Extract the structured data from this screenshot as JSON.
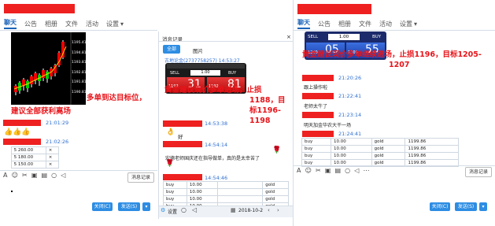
{
  "left": {
    "tabs": [
      "聊天",
      "公告",
      "相册",
      "文件",
      "活动",
      "设置"
    ],
    "chart_prices": [
      "1195.41",
      "1194.81",
      "1193.81",
      "1192.81",
      "1191.81",
      "1190.81",
      "1189.81"
    ],
    "msg1": "多单到达目标位，",
    "msg2": "建议全部获利离场",
    "time1": "21:01:29",
    "time2": "21:02:26",
    "rows": [
      {
        "value": "5 260.00",
        "close": "×"
      },
      {
        "value": "5 180.00",
        "close": "×"
      },
      {
        "value": "5 150.00",
        "close": "×"
      }
    ],
    "history_label": "消息记录",
    "close_btn": "关闭(C)",
    "send_btn": "发送(S)"
  },
  "mid": {
    "title": "消息记录",
    "tab_all": "全部",
    "tab_pic": "图片",
    "sender_line": "古地论金(2737758257) 14:53:27",
    "ticket": {
      "sell": "SELL",
      "buy": "BUY",
      "lot": "1.00",
      "sell_small": "1192",
      "sell_big": "31",
      "buy_small": "1192",
      "buy_big": "81"
    },
    "msg": "黄金建议现价多单进场，止损1188，目标1196-1198",
    "time1": "14:53:38",
    "good": "好",
    "time2": "14:54:14",
    "long_msg": "宏德老师国庆还在指导做单，真的是太幸苦了",
    "time3": "14:54:46",
    "table": [
      [
        "buy",
        "10.00",
        "gold"
      ],
      [
        "buy",
        "10.00",
        "gold"
      ],
      [
        "buy",
        "10.00",
        "gold"
      ],
      [
        "buy",
        "10.00",
        "gold"
      ]
    ],
    "settings": "设置",
    "date": "2018-10-2"
  },
  "right": {
    "tabs": [
      "聊天",
      "公告",
      "相册",
      "文件",
      "活动",
      "设置"
    ],
    "ticket": {
      "sell": "SELL",
      "buy": "BUY",
      "lot": "1.00",
      "sell_small": "1200",
      "sell_big": "05",
      "buy_small": "1200",
      "buy_big": "55"
    },
    "msg": "黄金建议现价多单继续进场，止损1196，目标1205-1207",
    "time1": "21:20:26",
    "line1": "跟上操作啦",
    "time2": "21:22:41",
    "line2": "老师太牛了",
    "time3": "21:23:14",
    "line3": "明天加金华农大干一场",
    "time4": "21:24:41",
    "table": [
      [
        "buy",
        "10.00",
        "gold",
        "1199.86"
      ],
      [
        "buy",
        "10.00",
        "gold",
        "1199.86"
      ],
      [
        "buy",
        "10.00",
        "gold",
        "1199.86"
      ],
      [
        "buy",
        "10.00",
        "gold",
        "1199.86"
      ]
    ],
    "history_label": "消息记录",
    "close_btn": "关闭(C)",
    "send_btn": "发送(S)"
  }
}
